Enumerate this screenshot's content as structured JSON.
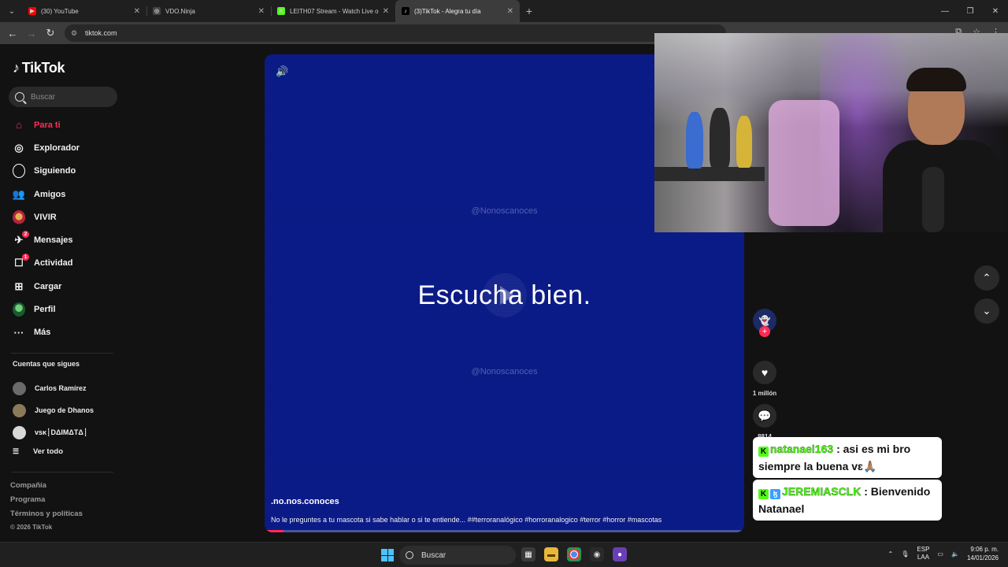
{
  "browser": {
    "tabs": [
      {
        "title": "(30) YouTube",
        "fav": "▶",
        "fav_bg": "#ff0000",
        "active": false
      },
      {
        "title": "VDO.Ninja",
        "fav": "◎",
        "fav_bg": "#444444",
        "active": false
      },
      {
        "title": "LEITH07 Stream - Watch Live o",
        "fav": "K",
        "fav_bg": "#53fc18",
        "active": false
      },
      {
        "title": "(3)TikTok - Alegra tu día",
        "fav": "♪",
        "fav_bg": "#000000",
        "active": true
      }
    ],
    "new_tab": "+",
    "url": "tiktok.com"
  },
  "tiktok": {
    "logo": "TikTok",
    "search_placeholder": "Buscar",
    "nav": [
      {
        "label": "Para ti",
        "icon": "home-icon",
        "glyph": "⌂",
        "active": true
      },
      {
        "label": "Explorador",
        "icon": "compass-icon",
        "glyph": "◎"
      },
      {
        "label": "Siguiendo",
        "icon": "following-icon",
        "glyph": "ring"
      },
      {
        "label": "Amigos",
        "icon": "friends-icon",
        "glyph": "👥"
      },
      {
        "label": "VIVIR",
        "icon": "live-avatar-icon",
        "glyph": "avatar"
      },
      {
        "label": "Mensajes",
        "icon": "messages-icon",
        "glyph": "✈",
        "badge": "2"
      },
      {
        "label": "Actividad",
        "icon": "activity-icon",
        "glyph": "☐",
        "badge": "1"
      },
      {
        "label": "Cargar",
        "icon": "upload-icon",
        "glyph": "⊞"
      },
      {
        "label": "Perfil",
        "icon": "profile-avatar-icon",
        "glyph": "avatar-green"
      },
      {
        "label": "Más",
        "icon": "more-icon",
        "glyph": "···"
      }
    ],
    "following_title": "Cuentas que sigues",
    "following": [
      {
        "name": "Carlos Ramírez",
        "color": "#6b6b6b"
      },
      {
        "name": "Juego de Dhanos",
        "color": "#8a7a5a"
      },
      {
        "name": "ᴠsᴋ┊DΔIMΔTΔ┊",
        "color": "#d8d8d8"
      }
    ],
    "see_all": "Ver todo",
    "footer_links": [
      "Compañía",
      "Programa",
      "Términos y políticas"
    ],
    "copyright": "© 2026 TikTok"
  },
  "video": {
    "watermark": "@Nonoscanoces",
    "caption": "Escucha bien.",
    "author": ".no.nos.conoces",
    "description": "No le preguntes a tu mascota si sabe hablar o si te entiende... ##terroranalógico #horroranalogico #terror #horror #mascotas",
    "progress": 0.04,
    "likes": "1 millón",
    "comments": "8814"
  },
  "chat": [
    {
      "badges": [
        "K"
      ],
      "user": "natanael163",
      "message": ": asi es mi bro siempre la buena vɛ🙏🏽"
    },
    {
      "badges": [
        "K",
        "ɮ"
      ],
      "user": "JEREMIASCLK",
      "message": ": Bienvenido Natanael"
    }
  ],
  "taskbar": {
    "search": "Buscar",
    "lang_top": "ESP",
    "lang_bottom": "LAA",
    "time": "9:06 p. m.",
    "date": "14/01/2026"
  }
}
